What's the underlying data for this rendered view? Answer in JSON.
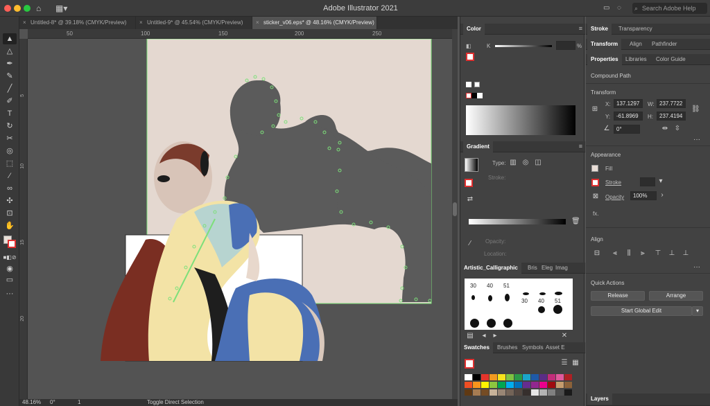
{
  "window": {
    "title": "Adobe Illustrator 2021",
    "search_placeholder": "Search Adobe Help"
  },
  "doc_tabs": [
    {
      "label": "Untitled-8* @ 39.18% (CMYK/Preview)"
    },
    {
      "label": "Untitled-9* @ 45.54% (CMYK/Preview)"
    },
    {
      "label": "sticker_v06.eps* @ 48.16% (CMYK/Preview)"
    }
  ],
  "ruler": {
    "h_ticks": [
      "50",
      "100",
      "150",
      "200",
      "250"
    ],
    "v_ticks": [
      "5",
      "10",
      "15",
      "20"
    ]
  },
  "status": {
    "zoom": "48.16%",
    "rotation": "0°",
    "artboard": "1",
    "tool_hint": "Toggle Direct Selection"
  },
  "color_panel": {
    "title": "Color",
    "channel": "K",
    "percent_sign": "%"
  },
  "gradient_panel": {
    "title": "Gradient",
    "type_label": "Type:",
    "stroke_label": "Stroke:",
    "opacity_label": "Opacity:",
    "location_label": "Location:"
  },
  "brushes_panel": {
    "tabs": [
      "Artistic_Calligraphic",
      "Bris",
      "Eleg",
      "Imag"
    ],
    "sizes": [
      "30",
      "40",
      "51",
      "30",
      "40",
      "51"
    ]
  },
  "swatches_panel": {
    "tabs": [
      "Swatches",
      "Brushes",
      "Symbols",
      "Asset E"
    ]
  },
  "swatch_colors": [
    "#ffffff",
    "#000000",
    "#e5342b",
    "#f29a20",
    "#f6e21c",
    "#7ec242",
    "#2a9a47",
    "#1aa5c9",
    "#1e5aa8",
    "#5a2d86",
    "#c22c7a",
    "#e05a9c",
    "#ad2024",
    "#f04e23",
    "#f7941d",
    "#fff200",
    "#8dc63f",
    "#00a651",
    "#00aeef",
    "#0072bc",
    "#662d91",
    "#92278f",
    "#ec008c",
    "#9e0b0f",
    "#c69c6d",
    "#8c6239",
    "#603913",
    "#a67c52",
    "#754c24",
    "#c7b299",
    "#998675",
    "#736357",
    "#534741",
    "#362f2d",
    "#e6e6e6",
    "#b3b3b3",
    "#808080",
    "#4d4d4d",
    "#1a1a1a"
  ],
  "right_tabs": {
    "row1": [
      "Stroke",
      "Transparency"
    ],
    "row2": [
      "Transform",
      "Align",
      "Pathfinder"
    ],
    "row3": [
      "Properties",
      "Libraries",
      "Color Guide"
    ]
  },
  "properties": {
    "object_type": "Compound Path",
    "transform_title": "Transform",
    "x_label": "X:",
    "x": "137.1297",
    "y_label": "Y:",
    "y": "-61.8969",
    "w_label": "W:",
    "w": "237.7722",
    "h_label": "H:",
    "h": "237.4194",
    "angle": "0°",
    "appearance_title": "Appearance",
    "fill_label": "Fill",
    "stroke_label": "Stroke",
    "opacity_label": "Opacity",
    "opacity_value": "100%",
    "fx_label": "fx.",
    "align_title": "Align",
    "quick_actions_title": "Quick Actions",
    "release_label": "Release",
    "arrange_label": "Arrange",
    "global_edit_label": "Start Global Edit",
    "layers_label": "Layers"
  }
}
